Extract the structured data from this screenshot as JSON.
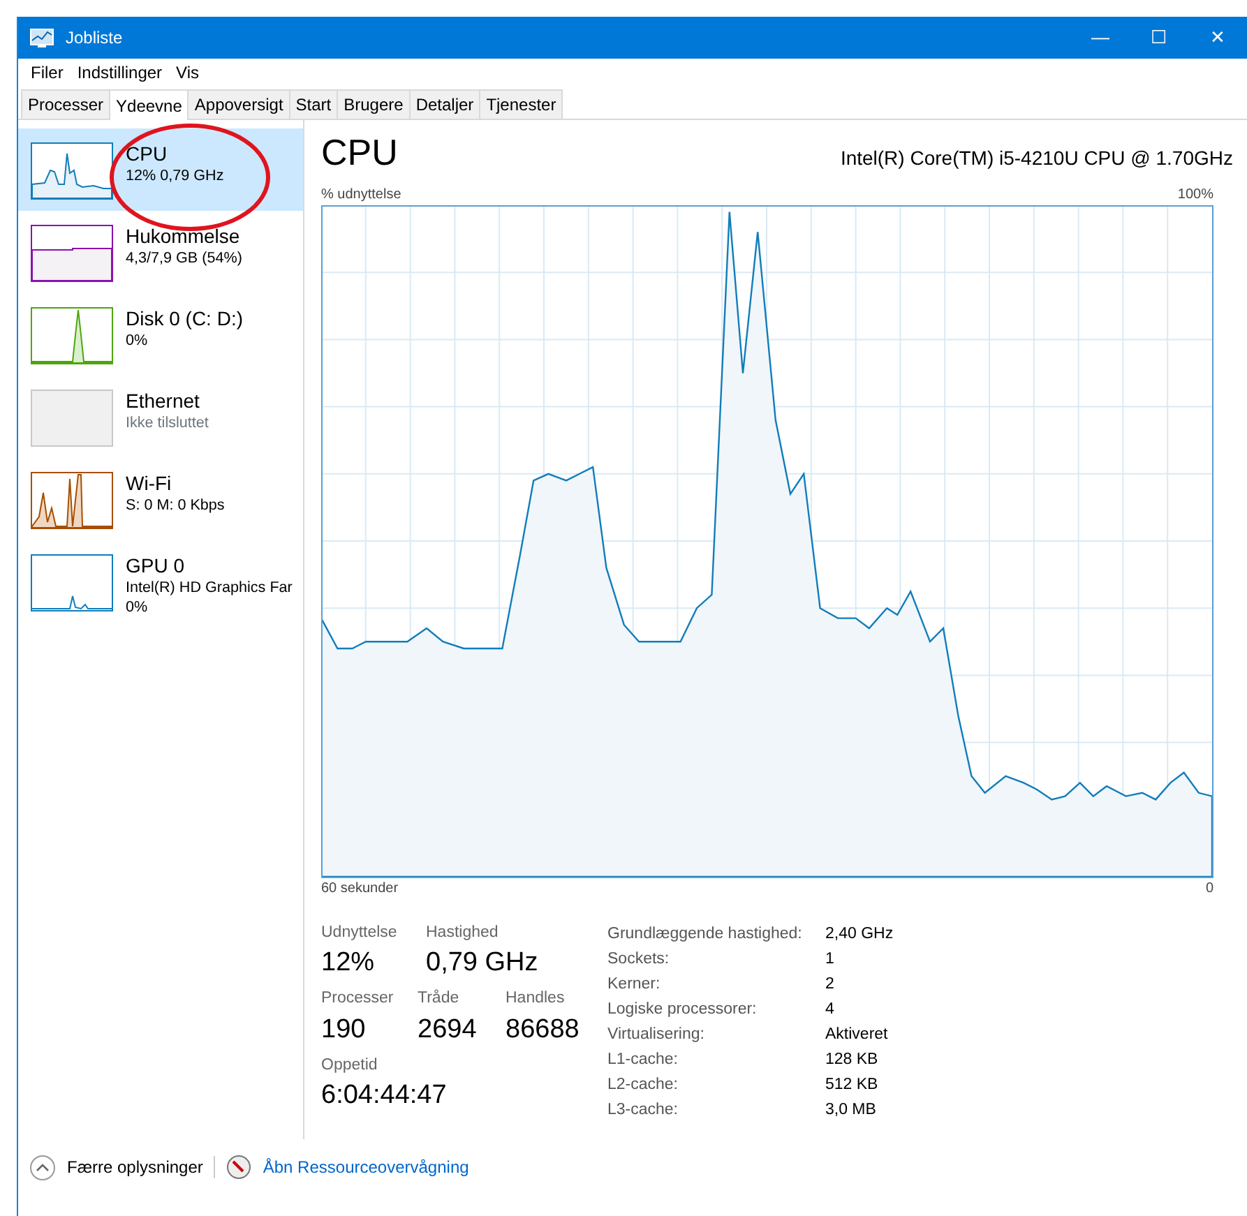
{
  "window": {
    "title": "Jobliste",
    "controls": [
      "—",
      "☐",
      "✕"
    ]
  },
  "menu": [
    "Filer",
    "Indstillinger",
    "Vis"
  ],
  "tabs": [
    {
      "label": "Processer",
      "selected": false
    },
    {
      "label": "Ydeevne",
      "selected": true
    },
    {
      "label": "Appoversigt",
      "selected": false
    },
    {
      "label": "Start",
      "selected": false
    },
    {
      "label": "Brugere",
      "selected": false
    },
    {
      "label": "Detaljer",
      "selected": false
    },
    {
      "label": "Tjenester",
      "selected": false
    }
  ],
  "sidebar": {
    "items": [
      {
        "kind": "cpu",
        "name": "CPU",
        "details": [
          "12% 0,79 GHz"
        ],
        "selected": true,
        "color": "#117dbb"
      },
      {
        "kind": "memory",
        "name": "Hukommelse",
        "details": [
          "4,3/7,9 GB (54%)"
        ],
        "selected": false,
        "color": "#8b12ae"
      },
      {
        "kind": "disk",
        "name": "Disk 0 (C: D:)",
        "details": [
          "0%"
        ],
        "selected": false,
        "color": "#4da60c"
      },
      {
        "kind": "ethernet",
        "name": "Ethernet",
        "details": [
          "Ikke tilsluttet"
        ],
        "selected": false,
        "color": "#c8c8c8"
      },
      {
        "kind": "wifi",
        "name": "Wi-Fi",
        "details": [
          "S: 0 M: 0 Kbps"
        ],
        "selected": false,
        "color": "#a74f01"
      },
      {
        "kind": "gpu",
        "name": "GPU 0",
        "details": [
          "Intel(R) HD Graphics Far",
          "0%"
        ],
        "selected": false,
        "color": "#117dbb"
      }
    ]
  },
  "annotation": {
    "color": "#e0141e"
  },
  "detail": {
    "title": "CPU",
    "model": "Intel(R) Core(TM) i5-4210U CPU @ 1.70GHz",
    "graph_label": "% udnyttelse",
    "y_max_label": "100%",
    "time_span_label": "60 sekunder",
    "time_end_label": "0",
    "stats": [
      [
        {
          "label": "Udnyttelse",
          "value": "12%"
        },
        {
          "label": "Hastighed",
          "value": "0,79 GHz"
        }
      ],
      [
        {
          "label": "Processer",
          "value": "190"
        },
        {
          "label": "Tråde",
          "value": "2694"
        },
        {
          "label": "Handles",
          "value": "86688"
        }
      ],
      [
        {
          "label": "Oppetid",
          "value": "6:04:44:47"
        }
      ]
    ],
    "specs": [
      {
        "key": "Grundlæggende hastighed:",
        "value": "2,40 GHz"
      },
      {
        "key": "Sockets:",
        "value": "1"
      },
      {
        "key": "Kerner:",
        "value": "2"
      },
      {
        "key": "Logiske processorer:",
        "value": "4"
      },
      {
        "key": "Virtualisering:",
        "value": "Aktiveret"
      },
      {
        "key": "L1-cache:",
        "value": "128 KB"
      },
      {
        "key": "L2-cache:",
        "value": "512 KB"
      },
      {
        "key": "L3-cache:",
        "value": "3,0 MB"
      }
    ]
  },
  "footer": {
    "toggle": "Færre oplysninger",
    "link": "Åbn Ressourceovervågning"
  }
}
